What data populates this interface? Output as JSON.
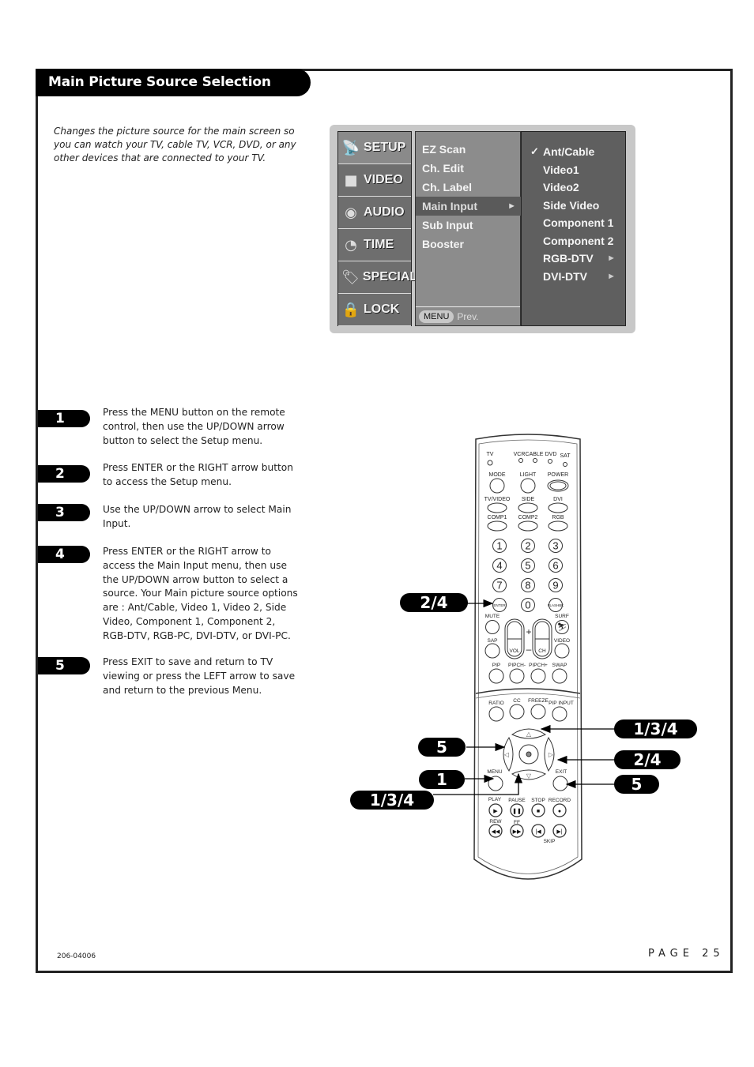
{
  "header": {
    "title": "Main Picture Source Selection"
  },
  "intro": "Changes the picture source for the main screen so you can watch your TV, cable TV, VCR, DVD, or any other devices that are connected to your TV.",
  "osd": {
    "categories": [
      {
        "label": "SETUP",
        "icon": "satellite-icon",
        "active": true
      },
      {
        "label": "VIDEO",
        "icon": "screen-icon",
        "active": false
      },
      {
        "label": "AUDIO",
        "icon": "speaker-icon",
        "active": false
      },
      {
        "label": "TIME",
        "icon": "clock-icon",
        "active": false
      },
      {
        "label": "SPECIAL",
        "icon": "tag-icon",
        "active": false
      },
      {
        "label": "LOCK",
        "icon": "lock-icon",
        "active": false
      }
    ],
    "menu_items": [
      {
        "label": "EZ Scan"
      },
      {
        "label": "Ch. Edit"
      },
      {
        "label": "Ch. Label"
      },
      {
        "label": "Main Input",
        "selected": true,
        "arrow": "►"
      },
      {
        "label": "Sub Input"
      },
      {
        "label": "Booster"
      }
    ],
    "footer": {
      "menu_button": "MENU",
      "prev_label": "Prev."
    },
    "sources": [
      {
        "label": "Ant/Cable",
        "checked": true,
        "check": "✓"
      },
      {
        "label": "Video1"
      },
      {
        "label": "Video2"
      },
      {
        "label": "Side Video"
      },
      {
        "label": "Component 1"
      },
      {
        "label": "Component 2"
      },
      {
        "label": "RGB-DTV",
        "arrow": "►"
      },
      {
        "label": "DVI-DTV",
        "arrow": "►"
      }
    ]
  },
  "steps": [
    {
      "num": "1",
      "text": "Press the MENU button on the remote control, then use the UP/DOWN arrow button to select the Setup menu."
    },
    {
      "num": "2",
      "text": "Press ENTER or the RIGHT arrow button to access the Setup menu."
    },
    {
      "num": "3",
      "text": "Use the UP/DOWN arrow to select Main Input."
    },
    {
      "num": "4",
      "text": "Press ENTER or the RIGHT arrow to access the Main Input menu, then use the UP/DOWN arrow button to select a source. Your Main picture source options are : Ant/Cable, Video 1, Video 2, Side Video, Component 1, Component 2, RGB-DTV, RGB-PC, DVI-DTV, or DVI-PC."
    },
    {
      "num": "5",
      "text": "Press EXIT to save and return to TV viewing or press the LEFT arrow to save and return to the previous Menu."
    }
  ],
  "remote": {
    "mode_labels": [
      "TV",
      "VCR",
      "CABLE",
      "DVD",
      "SAT"
    ],
    "row1": [
      "MODE",
      "LIGHT",
      "POWER"
    ],
    "row2": [
      "TV/VIDEO",
      "SIDE",
      "DVI"
    ],
    "row3": [
      "COMP1",
      "COMP2",
      "RGB"
    ],
    "digits": [
      "1",
      "2",
      "3",
      "4",
      "5",
      "6",
      "7",
      "8",
      "9",
      "ENTER",
      "0",
      "FLASHBK"
    ],
    "mute": "MUTE",
    "surf": "SURF",
    "sap": "SAP",
    "video": "VIDEO",
    "vol": "VOL",
    "ch": "CH",
    "plus": "+",
    "minus": "–",
    "pip_row": [
      "PIP",
      "PIPCH-",
      "PIPCH+",
      "SWAP"
    ],
    "ratio_row": [
      "RATIO",
      "CC",
      "FREEZE",
      "PIP INPUT"
    ],
    "menu": "MENU",
    "exit": "EXIT",
    "play_row": [
      "PLAY",
      "PAUSE",
      "STOP",
      "RECORD"
    ],
    "rew": "REW",
    "ff": "FF",
    "skip": "SKIP"
  },
  "callouts": {
    "enter": "2/4",
    "up": "1/3/4",
    "left": "5",
    "right": "2/4",
    "menu": "1",
    "exit": "5",
    "down": "1/3/4"
  },
  "footer": {
    "code": "206-04006",
    "page": "PAGE 25"
  }
}
